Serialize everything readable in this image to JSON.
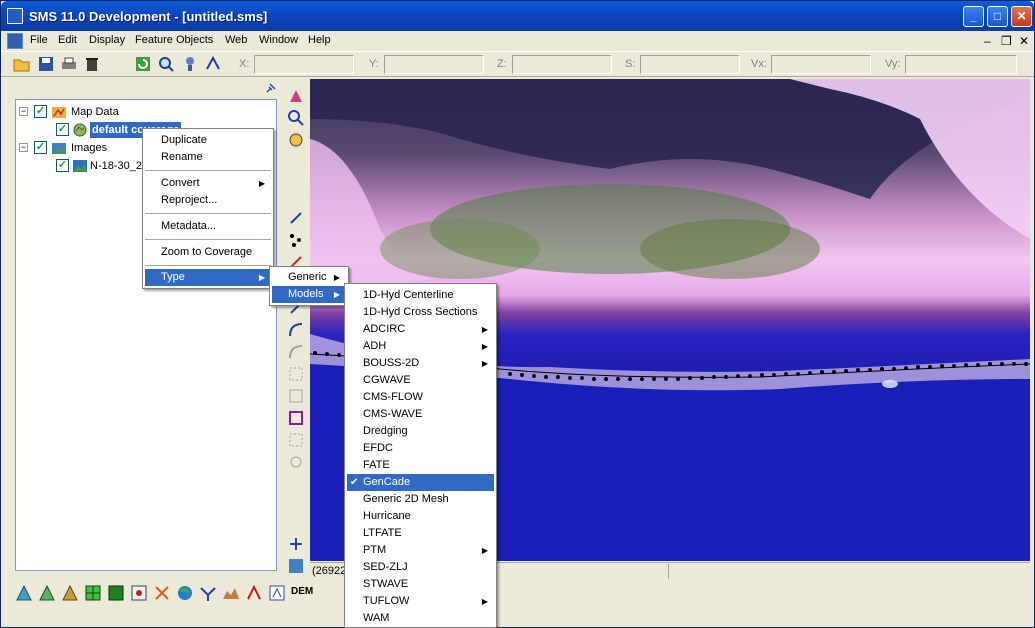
{
  "window": {
    "title": "SMS 11.0 Development - [untitled.sms]"
  },
  "title_buttons": {
    "minimize": "_",
    "maximize": "□",
    "close": "✕"
  },
  "menubar": {
    "items": [
      "File",
      "Edit",
      "Display",
      "Feature Objects",
      "Web",
      "Window",
      "Help"
    ],
    "mdi_controls": {
      "minimize": "–",
      "restore": "❐",
      "close": "✕"
    }
  },
  "coords": {
    "labels": [
      "X:",
      "Y:",
      "Z:",
      "S:",
      "Vx:",
      "Vy:"
    ]
  },
  "tree": {
    "map_data_label": "Map Data",
    "coverage_label": "default coverage",
    "images_label": "Images",
    "image_item_label": "N-18-30_2"
  },
  "context_menu": {
    "duplicate": "Duplicate",
    "rename": "Rename",
    "convert": "Convert",
    "reproject": "Reproject...",
    "metadata": "Metadata...",
    "zoom_to_coverage": "Zoom to Coverage",
    "type": "Type"
  },
  "type_submenu": {
    "generic": "Generic",
    "models": "Models"
  },
  "models_submenu": {
    "items": [
      {
        "label": "1D-Hyd Centerline",
        "has_sub": false,
        "checked": false
      },
      {
        "label": "1D-Hyd Cross Sections",
        "has_sub": false,
        "checked": false
      },
      {
        "label": "ADCIRC",
        "has_sub": true,
        "checked": false
      },
      {
        "label": "ADH",
        "has_sub": true,
        "checked": false
      },
      {
        "label": "BOUSS-2D",
        "has_sub": true,
        "checked": false
      },
      {
        "label": "CGWAVE",
        "has_sub": false,
        "checked": false
      },
      {
        "label": "CMS-FLOW",
        "has_sub": false,
        "checked": false
      },
      {
        "label": "CMS-WAVE",
        "has_sub": false,
        "checked": false
      },
      {
        "label": "Dredging",
        "has_sub": false,
        "checked": false
      },
      {
        "label": "EFDC",
        "has_sub": false,
        "checked": false
      },
      {
        "label": "FATE",
        "has_sub": false,
        "checked": false
      },
      {
        "label": "GenCade",
        "has_sub": false,
        "checked": true
      },
      {
        "label": "Generic 2D Mesh",
        "has_sub": false,
        "checked": false
      },
      {
        "label": "Hurricane",
        "has_sub": false,
        "checked": false
      },
      {
        "label": "LTFATE",
        "has_sub": false,
        "checked": false
      },
      {
        "label": "PTM",
        "has_sub": true,
        "checked": false
      },
      {
        "label": "SED-ZLJ",
        "has_sub": false,
        "checked": false
      },
      {
        "label": "STWAVE",
        "has_sub": false,
        "checked": false
      },
      {
        "label": "TUFLOW",
        "has_sub": true,
        "checked": false
      },
      {
        "label": "WAM",
        "has_sub": false,
        "checked": false
      }
    ]
  },
  "status": {
    "text": "(26922"
  },
  "bottom_toolbar": {
    "dem_label": "DEM"
  },
  "colors": {
    "selection": "#316ac5",
    "titlebar": "#0b46c0",
    "water": "#1a1fb8"
  }
}
